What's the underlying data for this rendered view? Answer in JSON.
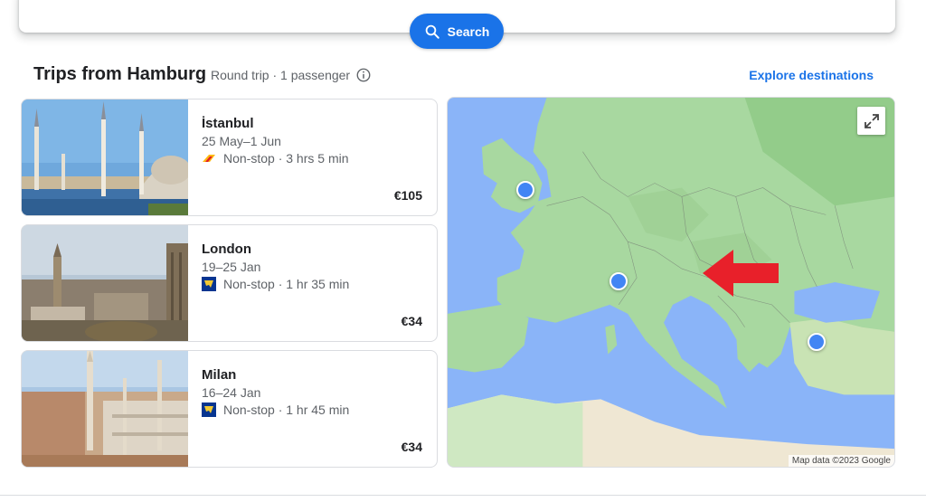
{
  "search": {
    "button_label": "Search"
  },
  "header": {
    "title": "Trips from Hamburg",
    "subtitle": "Round trip · 1 passenger",
    "explore_label": "Explore destinations"
  },
  "trips": [
    {
      "city": "İstanbul",
      "dates": "25 May–1 Jun",
      "flight": "Non-stop · 3 hrs 5 min",
      "price": "€105"
    },
    {
      "city": "London",
      "dates": "19–25 Jan",
      "flight": "Non-stop · 1 hr 35 min",
      "price": "€34"
    },
    {
      "city": "Milan",
      "dates": "16–24 Jan",
      "flight": "Non-stop · 1 hr 45 min",
      "price": "€34"
    }
  ],
  "map": {
    "credit": "Map data ©2023 Google"
  },
  "colors": {
    "accent": "#1a73e8",
    "pin": "#4285f4",
    "arrow": "#e8202a",
    "land": "#a8d8a0",
    "water": "#8ab4f8"
  },
  "icons": [
    "search-icon",
    "info-icon",
    "expand-icon",
    "pegasus-logo-icon",
    "ryanair-logo-icon",
    "red-arrow-icon"
  ]
}
